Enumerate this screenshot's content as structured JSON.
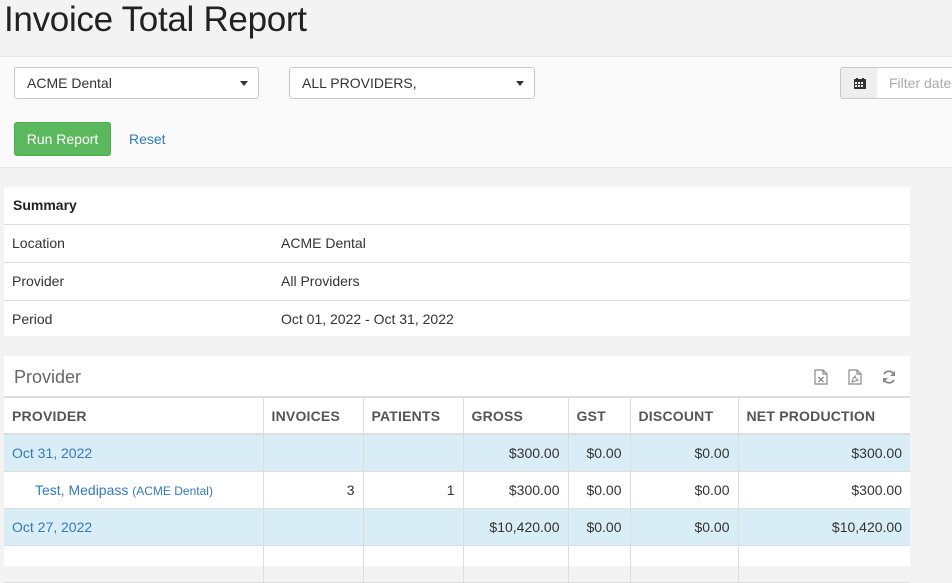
{
  "page": {
    "title": "Invoice Total Report"
  },
  "filters": {
    "location_selected": "ACME Dental",
    "provider_selected": "ALL PROVIDERS,",
    "date_placeholder": "Filter date"
  },
  "actions": {
    "run_label": "Run Report",
    "reset_label": "Reset"
  },
  "summary": {
    "heading": "Summary",
    "rows": [
      {
        "label": "Location",
        "value": "ACME Dental"
      },
      {
        "label": "Provider",
        "value": "All Providers"
      },
      {
        "label": "Period",
        "value": "Oct 01, 2022 - Oct 31, 2022"
      }
    ]
  },
  "provider_panel": {
    "title": "Provider",
    "icons": [
      "excel-export-icon",
      "pdf-export-icon",
      "refresh-icon"
    ],
    "columns": [
      "PROVIDER",
      "INVOICES",
      "PATIENTS",
      "GROSS",
      "GST",
      "DISCOUNT",
      "NET PRODUCTION"
    ],
    "rows": [
      {
        "type": "group",
        "provider": "Oct 31, 2022",
        "invoices": "",
        "patients": "",
        "gross": "$300.00",
        "gst": "$0.00",
        "discount": "$0.00",
        "net": "$300.00"
      },
      {
        "type": "item",
        "provider": "Test, Medipass",
        "location": "(ACME Dental)",
        "invoices": "3",
        "patients": "1",
        "gross": "$300.00",
        "gst": "$0.00",
        "discount": "$0.00",
        "net": "$300.00"
      },
      {
        "type": "group",
        "provider": "Oct 27, 2022",
        "invoices": "",
        "patients": "",
        "gross": "$10,420.00",
        "gst": "$0.00",
        "discount": "$0.00",
        "net": "$10,420.00"
      },
      {
        "type": "item",
        "provider": "",
        "location": "",
        "invoices": "",
        "patients": "",
        "gross": "",
        "gst": "",
        "discount": "",
        "net": ""
      }
    ]
  },
  "colors": {
    "accent_green": "#5cb85c",
    "link_blue": "#337ab7",
    "group_row_bg": "#d9edf7"
  }
}
